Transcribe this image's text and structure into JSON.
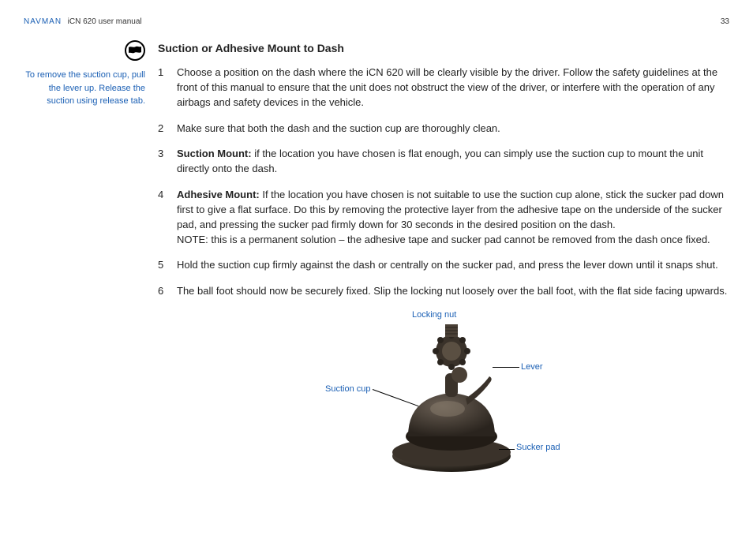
{
  "header": {
    "brand": "NAVMAN",
    "manual": "iCN 620 user manual",
    "page": "33"
  },
  "side_note": "To remove the suction cup, pull the lever up. Release the suction using release tab.",
  "section_title": "Suction or Adhesive Mount to Dash",
  "steps": [
    {
      "n": "1",
      "prefix": "",
      "body": "Choose a position on the dash where the iCN 620 will be clearly visible by the driver. Follow the safety guidelines at the front of this manual to ensure that the unit does not obstruct the view of the driver, or interfere with the operation of any airbags and safety devices in the vehicle."
    },
    {
      "n": "2",
      "prefix": "",
      "body": "Make sure that both the dash and the suction cup are thoroughly clean."
    },
    {
      "n": "3",
      "prefix": "Suction Mount:",
      "body": " if the location you have chosen is flat enough, you can simply use the suction cup to mount the unit directly onto the dash."
    },
    {
      "n": "4",
      "prefix": "Adhesive Mount:",
      "body": " If the location you have chosen is not suitable to use the suction cup alone, stick the sucker pad down first to give a flat surface. Do this by removing the protective layer from the adhesive tape on the underside of the sucker pad, and pressing the sucker pad firmly down for 30 seconds in the desired position on the dash.\nNOTE: this is a permanent solution – the adhesive tape and sucker pad cannot be removed from the dash once fixed."
    },
    {
      "n": "5",
      "prefix": "",
      "body": "Hold the suction cup firmly against the dash or centrally on the sucker pad, and press the lever down until it snaps shut."
    },
    {
      "n": "6",
      "prefix": "",
      "body": "The ball foot should now be securely fixed. Slip the locking nut loosely over the ball foot, with the flat side facing upwards."
    }
  ],
  "figure_labels": {
    "locking_nut": "Locking nut",
    "lever": "Lever",
    "suction_cup": "Suction cup",
    "sucker_pad": "Sucker pad"
  }
}
